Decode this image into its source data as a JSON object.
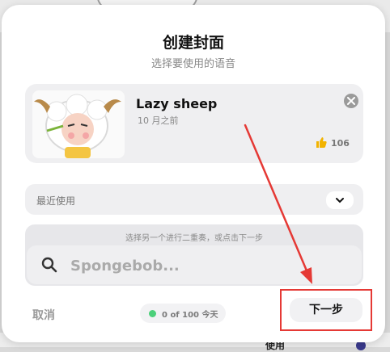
{
  "modal": {
    "title": "创建封面",
    "subtitle": "选择要使用的语音"
  },
  "voice": {
    "name": "Lazy sheep",
    "date": "10 月之前",
    "likes": "106",
    "avatar_icon": "sheep-avatar"
  },
  "recent": {
    "label": "最近使用",
    "chevron_icon": "chevron-down-icon"
  },
  "search": {
    "hint": "选择另一个进行二重奏，或点击下一步",
    "placeholder": "Spongebob..."
  },
  "footer": {
    "cancel_label": "取消",
    "quota_text": "0 of 100 今天",
    "next_label": "下一步"
  },
  "colors": {
    "annotation": "#e53935",
    "quota_dot": "#4cd07a"
  },
  "background": {
    "partial_text": "使用"
  }
}
